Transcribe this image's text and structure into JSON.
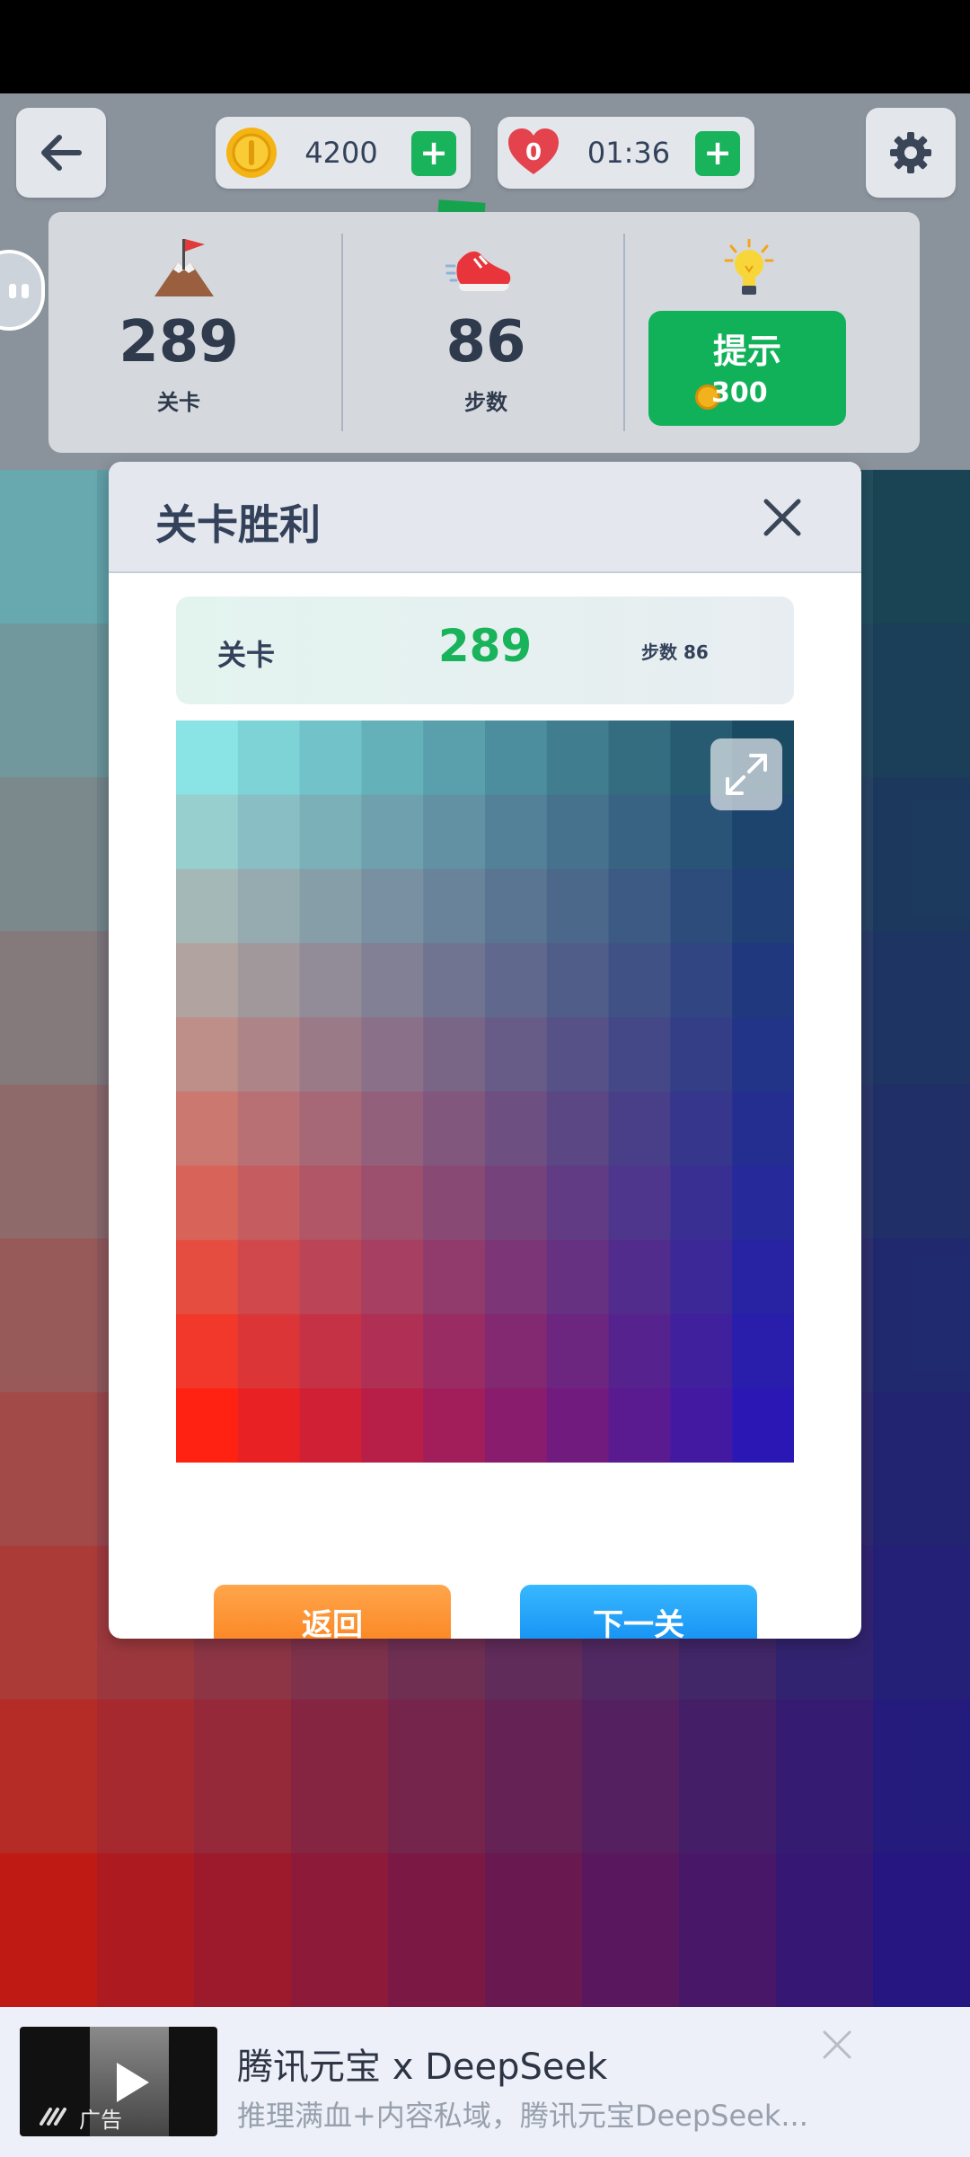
{
  "top_bar": {
    "coins": "4200",
    "timer": "01:36",
    "lives": "0"
  },
  "stats": {
    "level_value": "289",
    "level_label": "关卡",
    "steps_value": "86",
    "steps_label": "步数",
    "hint_label": "提示",
    "hint_cost": "300"
  },
  "modal": {
    "title": "关卡胜利",
    "level_label": "关卡",
    "level_value": "289",
    "steps_text": "步数 86",
    "back_label": "返回",
    "next_label": "下一关"
  },
  "puzzle_colors": {
    "top_left": "#8ae4e6",
    "top_right": "#1b4a63",
    "bottom_left": "#ff2212",
    "bottom_right": "#2b18b4",
    "columns": 10,
    "rows": 10
  },
  "background_colors": {
    "top_left": "#78c8cd",
    "top_right": "#1a4c5e",
    "bottom_left": "#e31c10",
    "bottom_right": "#291595",
    "columns": 10,
    "rows": 10
  },
  "ad": {
    "tag": "广告",
    "title": "腾讯元宝 x DeepSeek",
    "description": "推理满血+内容私域，腾讯元宝DeepSeek..."
  },
  "icons": {
    "back": "arrow-left-icon",
    "coin": "coin-icon",
    "heart": "heart-icon",
    "settings": "gear-icon",
    "level": "mountain-flag-icon",
    "steps": "sneaker-icon",
    "hint": "lightbulb-icon",
    "close": "close-icon",
    "expand": "expand-icon",
    "play": "play-icon"
  }
}
